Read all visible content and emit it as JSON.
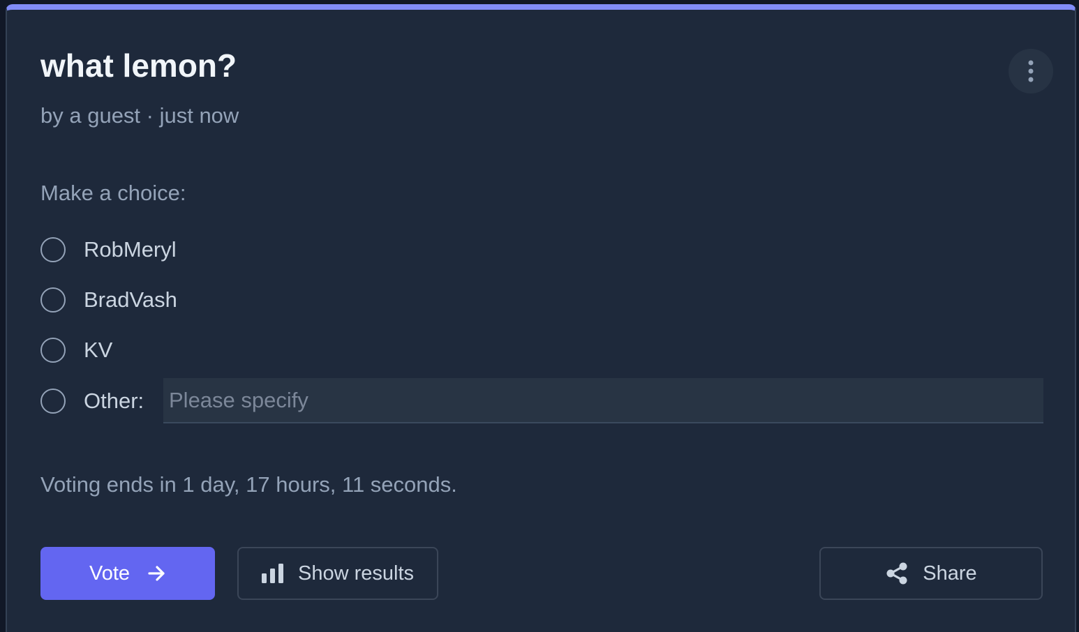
{
  "poll": {
    "title": "what lemon?",
    "meta": "by a guest · just now",
    "prompt": "Make a choice:",
    "options": [
      {
        "label": "RobMeryl"
      },
      {
        "label": "BradVash"
      },
      {
        "label": "KV"
      }
    ],
    "other": {
      "label": "Other:",
      "placeholder": "Please specify",
      "value": ""
    },
    "countdown": "Voting ends in 1 day, 17 hours, 11 seconds."
  },
  "actions": {
    "vote_label": "Vote",
    "results_label": "Show results",
    "share_label": "Share"
  },
  "icons": {
    "menu": "more-vertical-icon",
    "vote": "arrow-right-icon",
    "results": "bar-chart-icon",
    "share": "share-icon"
  },
  "colors": {
    "accent": "#6366f1",
    "top_bar": "#818cf8",
    "card_background": "#1e293b"
  }
}
